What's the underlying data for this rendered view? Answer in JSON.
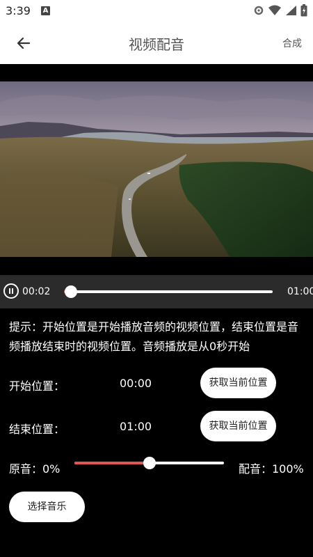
{
  "status_bar": {
    "time": "3:39",
    "notification_badge": "A",
    "icons": [
      "settings-icon",
      "wifi-icon",
      "cellular-signal-icon",
      "battery-icon"
    ]
  },
  "app_bar": {
    "back_icon": "arrow-left-icon",
    "title": "视频配音",
    "action_label": "合成"
  },
  "player": {
    "play_state_icon": "pause-icon",
    "current_time": "00:02",
    "total_time": "01:00",
    "progress_fraction": 0.0333
  },
  "hint": "提示：开始位置是开始播放音频的视频位置，结束位置是音频播放结束时的视频位置。音频播放是从0秒开始",
  "start_row": {
    "label": "开始位置：",
    "value": "00:00",
    "button_label": "获取当前位置"
  },
  "end_row": {
    "label": "结束位置：",
    "value": "01:00",
    "button_label": "获取当前位置"
  },
  "mix": {
    "original_label": "原音：0%",
    "dub_label": "配音：100%",
    "dub_fraction": 0.5
  },
  "choose_music_label": "选择音乐",
  "colors": {
    "accent": "#e05555",
    "background": "#000000",
    "player_bar": "#2b2b2b",
    "surface": "#ffffff"
  }
}
